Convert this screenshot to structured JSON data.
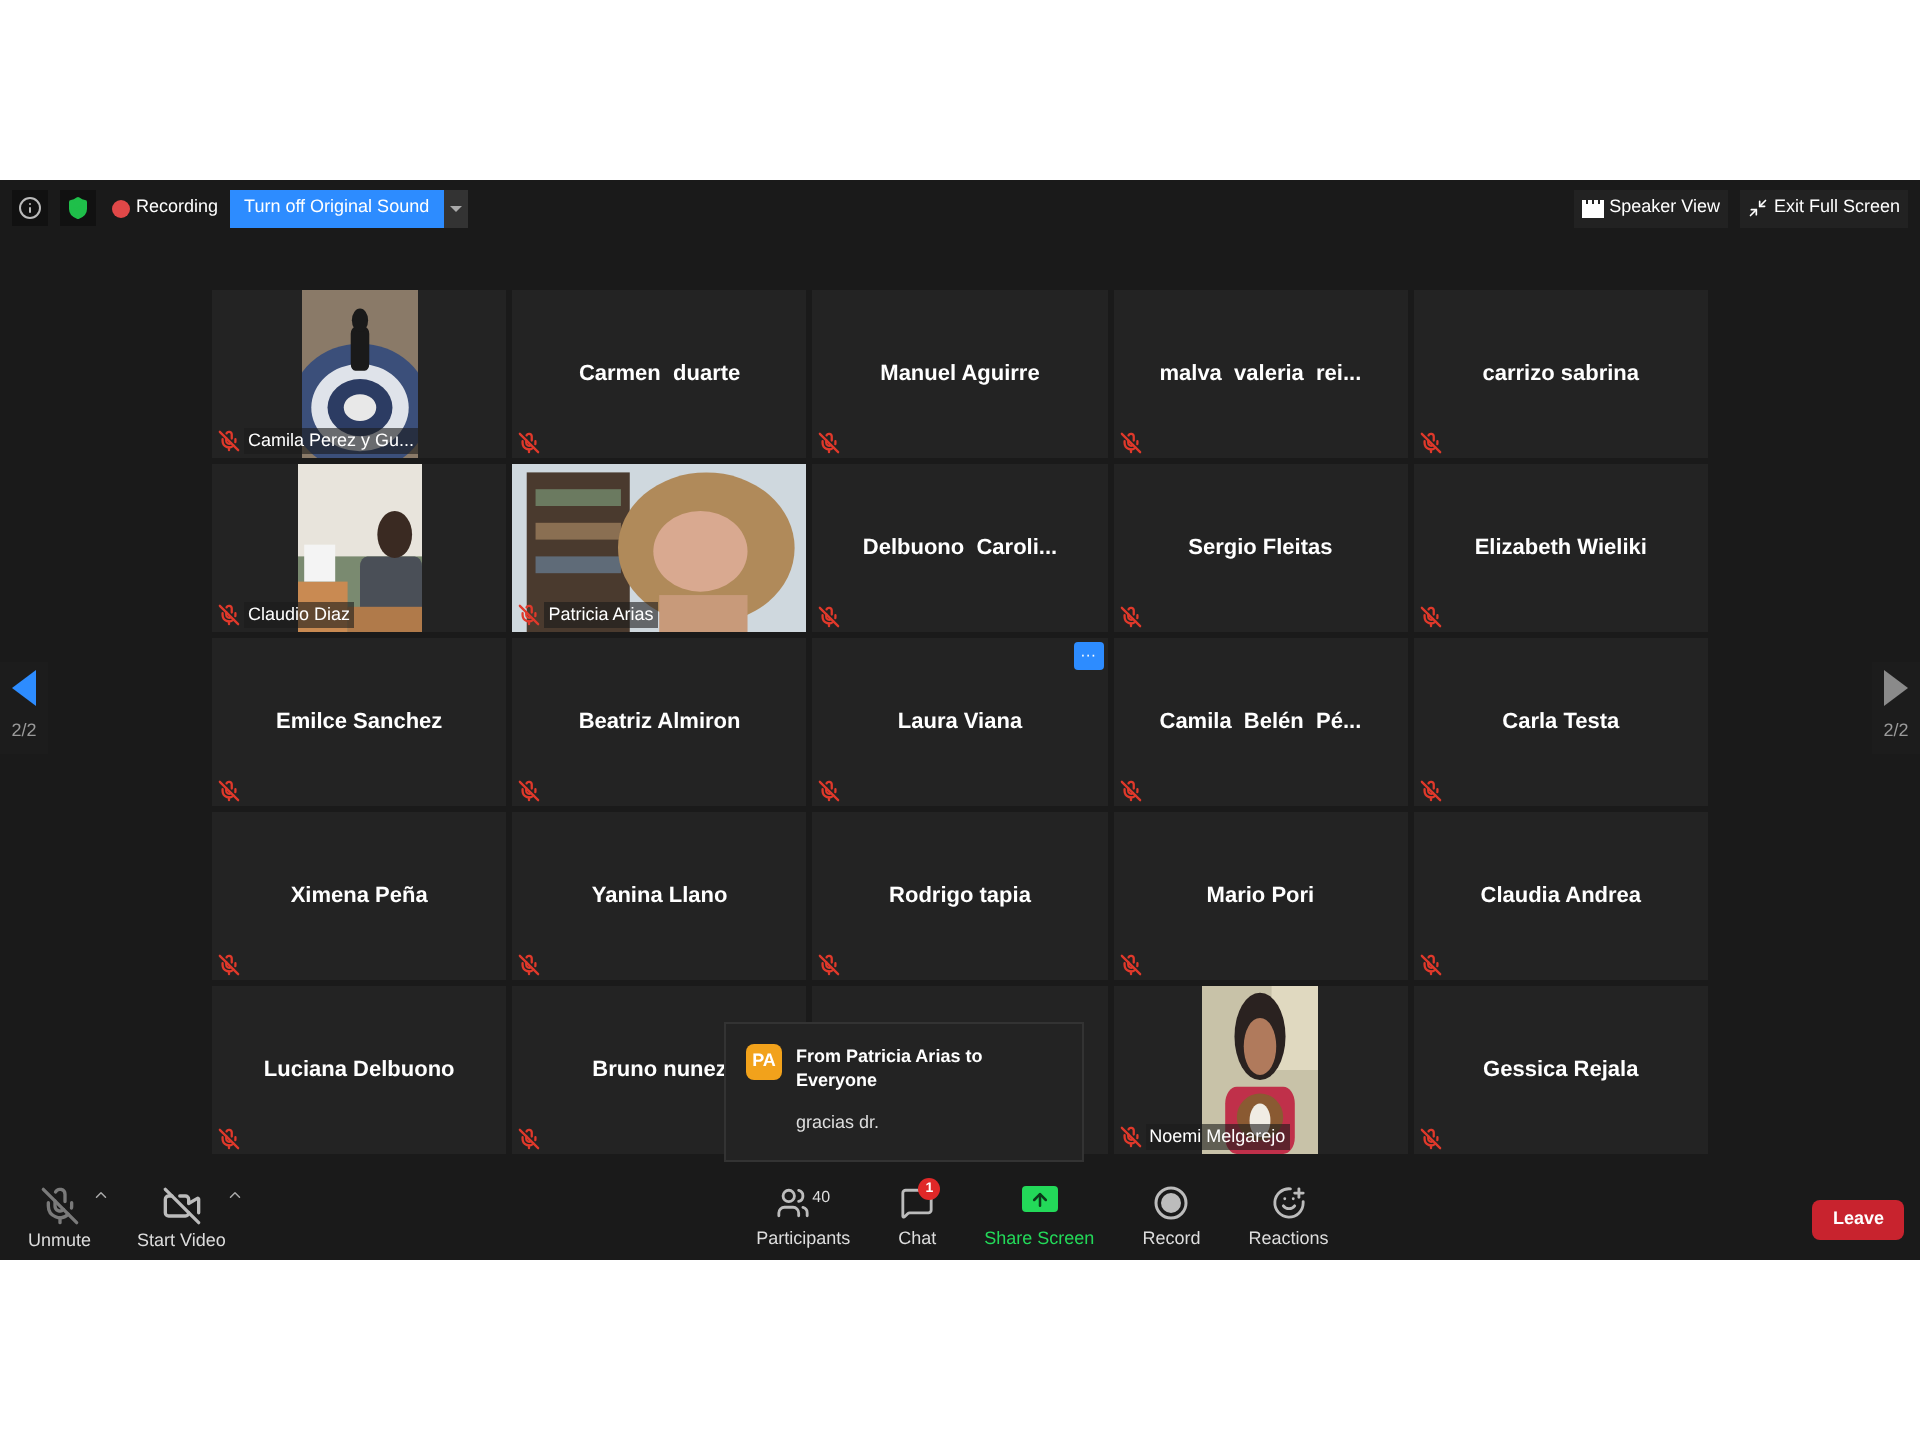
{
  "top_bar": {
    "recording": "Recording",
    "original_sound_button": "Turn off Original Sound",
    "speaker_view": "Speaker View",
    "exit_full_screen": "Exit Full Screen"
  },
  "page_nav": {
    "prev": {
      "label": "2/2",
      "disabled": false
    },
    "next": {
      "label": "2/2",
      "disabled": true
    }
  },
  "tiles": [
    {
      "kind": "video",
      "name": "Camila Perez y Gu...",
      "muted": true
    },
    {
      "kind": "name",
      "name": "Carmen  duarte",
      "muted": true
    },
    {
      "kind": "name",
      "name": "Manuel Aguirre",
      "muted": true
    },
    {
      "kind": "name",
      "name": "malva  valeria  rei...",
      "muted": true
    },
    {
      "kind": "name",
      "name": "carrizo sabrina",
      "muted": true
    },
    {
      "kind": "video",
      "name": "Claudio Diaz",
      "muted": true
    },
    {
      "kind": "video",
      "name": "Patricia Arias",
      "muted": true
    },
    {
      "kind": "name",
      "name": "Delbuono  Caroli...",
      "muted": true
    },
    {
      "kind": "name",
      "name": "Sergio Fleitas",
      "muted": true
    },
    {
      "kind": "name",
      "name": "Elizabeth Wieliki",
      "muted": true
    },
    {
      "kind": "name",
      "name": "Emilce Sanchez",
      "muted": true
    },
    {
      "kind": "name",
      "name": "Beatriz Almiron",
      "muted": true
    },
    {
      "kind": "name",
      "name": "Laura Viana",
      "muted": true,
      "menu": "···"
    },
    {
      "kind": "name",
      "name": "Camila  Belén  Pé...",
      "muted": true
    },
    {
      "kind": "name",
      "name": "Carla Testa",
      "muted": true
    },
    {
      "kind": "name",
      "name": "Ximena Peña",
      "muted": true
    },
    {
      "kind": "name",
      "name": "Yanina Llano",
      "muted": true
    },
    {
      "kind": "name",
      "name": "Rodrigo tapia",
      "muted": true
    },
    {
      "kind": "name",
      "name": "Mario Pori",
      "muted": true
    },
    {
      "kind": "name",
      "name": "Claudia Andrea",
      "muted": true
    },
    {
      "kind": "name",
      "name": "Luciana Delbuono",
      "muted": true
    },
    {
      "kind": "name",
      "name": "Bruno nunez",
      "muted": true
    },
    {
      "kind": "hidden"
    },
    {
      "kind": "video",
      "name": "Noemi Melgarejo",
      "muted": true
    },
    {
      "kind": "name",
      "name": "Gessica Rejala",
      "muted": true
    }
  ],
  "chat_popup": {
    "avatar": "PA",
    "title": "From Patricia Arias to Everyone",
    "message": "gracias dr."
  },
  "toolbar": {
    "left": [
      {
        "kind": "mic",
        "label": "Unmute"
      },
      {
        "kind": "video",
        "label": "Start Video"
      }
    ],
    "center": [
      {
        "kind": "participants",
        "label": "Participants",
        "count": "40"
      },
      {
        "kind": "chat",
        "label": "Chat",
        "badge": "1"
      },
      {
        "kind": "share",
        "label": "Share Screen"
      },
      {
        "kind": "record",
        "label": "Record"
      },
      {
        "kind": "reactions",
        "label": "Reactions"
      }
    ],
    "leave": "Leave"
  }
}
